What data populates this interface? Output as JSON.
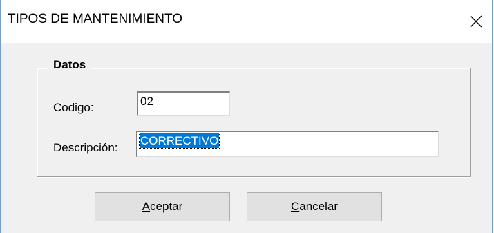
{
  "window": {
    "title": "TIPOS DE MANTENIMIENTO",
    "close_icon": "close-icon"
  },
  "group": {
    "legend": "Datos"
  },
  "form": {
    "codigo_label": "Codigo:",
    "codigo_value": "02",
    "descripcion_label": "Descripción:",
    "descripcion_value": "CORRECTIVO"
  },
  "buttons": {
    "aceptar_accel": "A",
    "aceptar_rest": "ceptar",
    "cancelar_accel": "C",
    "cancelar_rest": "ancelar"
  },
  "colors": {
    "selection": "#0078d7",
    "dialog_bg": "#f0f0f0",
    "button_bg": "#e1e1e1"
  }
}
